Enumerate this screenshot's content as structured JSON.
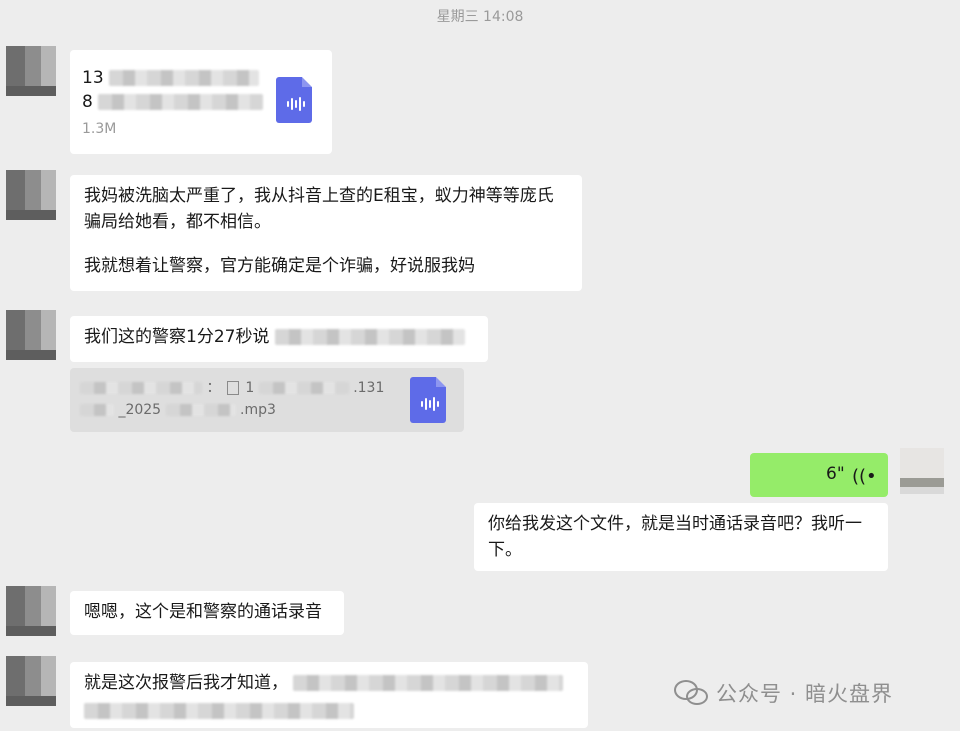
{
  "chat": {
    "timestamp": "星期三 14:08",
    "file1": {
      "line1": "13",
      "line2": "8",
      "size": "1.3M"
    },
    "msg1_line1": "我妈被洗脑太严重了，我从抖音上查的E租宝，蚁力神等等庞氏",
    "msg1_line2": "骗局给她看，都不相信。",
    "msg1_line3": "我就想着让警察，官方能确定是个诈骗，好说服我妈",
    "msg2": "我们这的警察1分27秒说",
    "file2": {
      "line1_a": "：",
      "line1_b": "1",
      "line1_c": ".131",
      "line2_a": "_2025",
      "line2_b": ".mp3"
    },
    "voice": {
      "duration": "6\""
    },
    "msg3_line1": "你给我发这个文件，就是当时通话录音吧？我听一",
    "msg3_line2": "下。",
    "msg4": "嗯嗯，这个是和警察的通话录音",
    "msg5": "就是这次报警后我才知道，"
  },
  "watermark": {
    "text": "公众号 · 暗火盘界"
  },
  "colors": {
    "background": "#ededed",
    "outgoing": "#95ec69",
    "file_icon": "#5e6be8"
  },
  "icons": [
    "audio-file-icon",
    "voice-wave-icon",
    "wechat-icon"
  ]
}
